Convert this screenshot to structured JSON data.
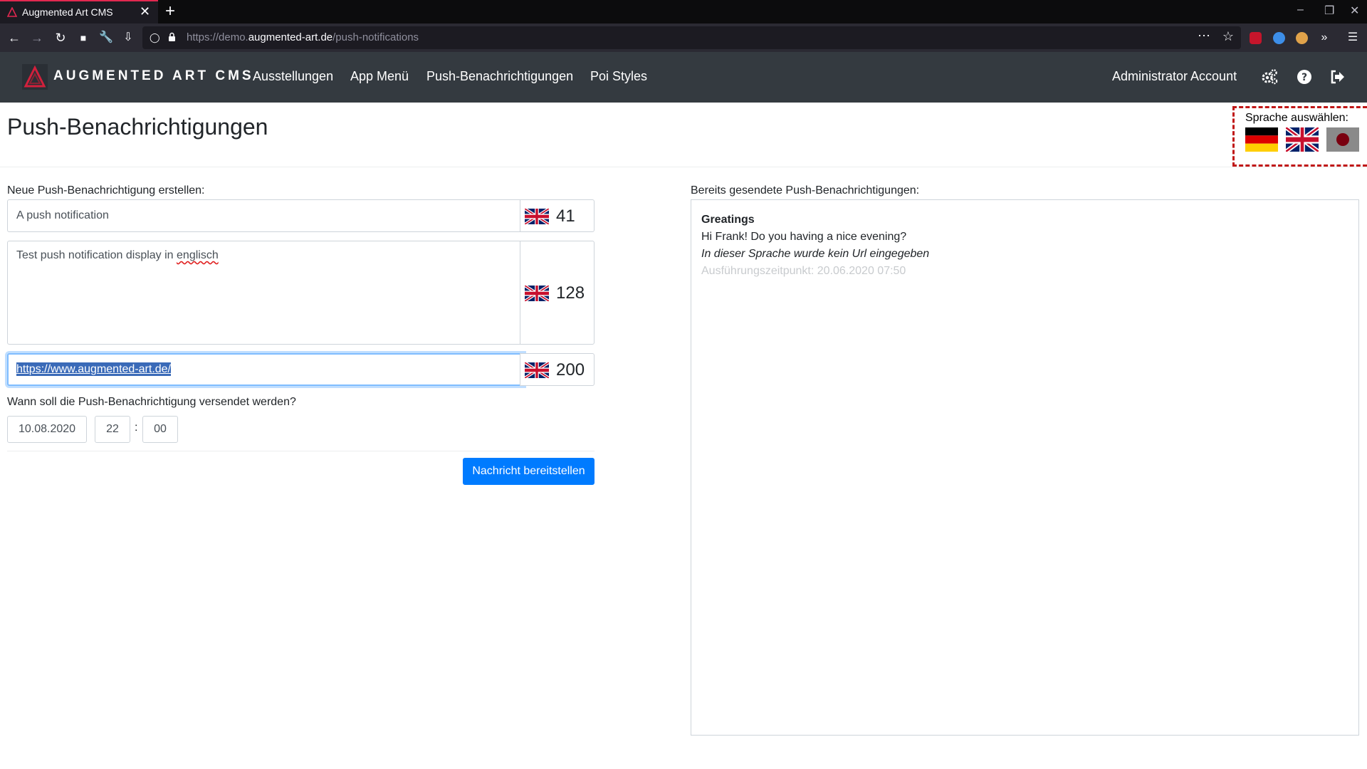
{
  "browser": {
    "tab_title": "Augmented Art CMS",
    "tab_close": "✕",
    "new_tab": "+",
    "url_prefix": "https://demo.",
    "url_host": "augmented-art.de",
    "url_path": "/push-notifications",
    "window_controls": [
      "–",
      "❐",
      "✕"
    ]
  },
  "header": {
    "brand": "AUGMENTED ART CMS",
    "menu": [
      "Ausstellungen",
      "App Menü",
      "Push-Benachrichtigungen",
      "Poi Styles"
    ],
    "account": "Administrator Account"
  },
  "page": {
    "title": "Push-Benachrichtigungen",
    "language_label": "Sprache auswählen:"
  },
  "form": {
    "section_label": "Neue Push-Benachrichtigung erstellen:",
    "title_value": "A push notification",
    "title_count": "41",
    "body_value_prefix": "Test push notification display in ",
    "body_value_misspelled": "englisch",
    "body_count": "128",
    "url_value": "https://www.augmented-art.de/",
    "url_count": "200",
    "schedule_label": "Wann soll die Push-Benachrichtigung versendet werden?",
    "date": "10.08.2020",
    "hour": "22",
    "separator": ":",
    "minute": "00",
    "submit_label": "Nachricht bereitstellen"
  },
  "sent": {
    "section_label": "Bereits gesendete Push-Benachrichtigungen:",
    "items": [
      {
        "title": "Greatings",
        "body": "Hi Frank! Do you having a nice evening?",
        "no_url_note": "In dieser Sprache wurde kein Url eingegeben",
        "executed_at": "Ausführungszeitpunkt: 20.06.2020 07:50"
      }
    ]
  },
  "colors": {
    "header_bg": "#343a40",
    "primary": "#007bff",
    "language_box_border": "#c01717",
    "browser_accent": "#e22850"
  }
}
